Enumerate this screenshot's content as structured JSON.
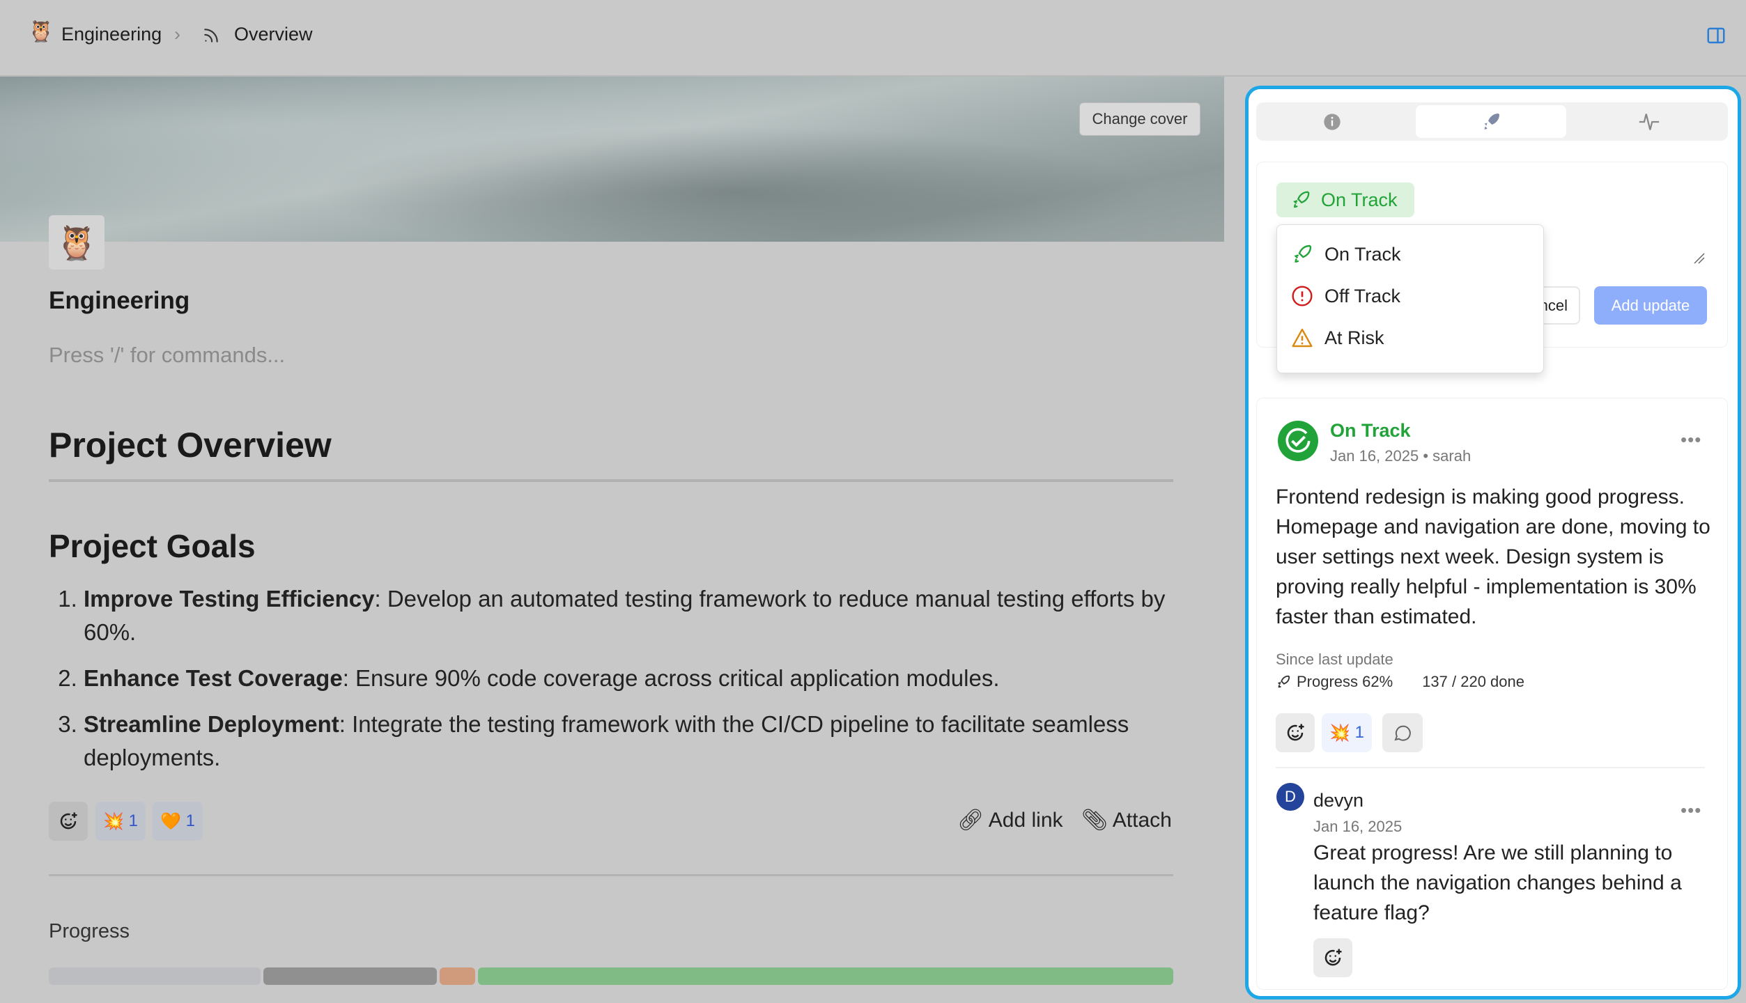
{
  "breadcrumb": {
    "workspace": "Engineering",
    "page": "Overview"
  },
  "cover": {
    "change_label": "Change cover"
  },
  "page": {
    "title": "Engineering",
    "placeholder": "Press '/' for commands...",
    "heading": "Project Overview",
    "subheading": "Project Goals",
    "goals": [
      {
        "bold": "Improve Testing Efficiency",
        "text": ": Develop an automated testing framework to reduce manual testing efforts by 60%."
      },
      {
        "bold": "Enhance Test Coverage",
        "text": ": Ensure 90% code coverage across critical application modules."
      },
      {
        "bold": "Streamline Deployment",
        "text": ": Integrate the testing framework with the CI/CD pipeline to facilitate seamless deployments."
      }
    ],
    "reactions": [
      {
        "emoji": "💥",
        "count": "1"
      },
      {
        "emoji": "🧡",
        "count": "1"
      }
    ],
    "add_link": "Add link",
    "attach": "Attach",
    "progress_label": "Progress",
    "progress_segments": [
      {
        "percent": 19,
        "color": "#bcbdc1"
      },
      {
        "percent": 15.5,
        "color": "#909090"
      },
      {
        "percent": 3.2,
        "color": "#cf9b7c"
      },
      {
        "percent": 62.3,
        "color": "#80bb86"
      }
    ]
  },
  "panel": {
    "tabs": [
      {
        "icon": "info-icon"
      },
      {
        "icon": "rocket-icon",
        "active": true
      },
      {
        "icon": "activity-icon"
      }
    ],
    "status_chip": "On Track",
    "status_options": [
      {
        "label": "On Track",
        "icon": "rocket-icon",
        "color": "#22a33a"
      },
      {
        "label": "Off Track",
        "icon": "alert-circle-icon",
        "color": "#d11a1a"
      },
      {
        "label": "At Risk",
        "icon": "warning-icon",
        "color": "#d98a10"
      }
    ],
    "cancel_label": "ncel",
    "add_update_label": "Add update",
    "update": {
      "status": "On Track",
      "meta": "Jan 16, 2025 • sarah",
      "body": "Frontend redesign is making good progress. Homepage and navigation are done, moving to user settings next week. Design system is proving really helpful - implementation is 30% faster than estimated.",
      "since": "Since last update",
      "progress": "Progress 62%",
      "done": "137 / 220 done",
      "reaction": {
        "emoji": "💥",
        "count": "1"
      }
    },
    "comment": {
      "initial": "D",
      "author": "devyn",
      "date": "Jan 16, 2025",
      "body": "Great progress! Are we still planning to launch the navigation changes behind a feature flag?"
    }
  },
  "colors": {
    "accent": "#1ea7e6",
    "on_track": "#22a33a",
    "button": "#8eaefb"
  }
}
